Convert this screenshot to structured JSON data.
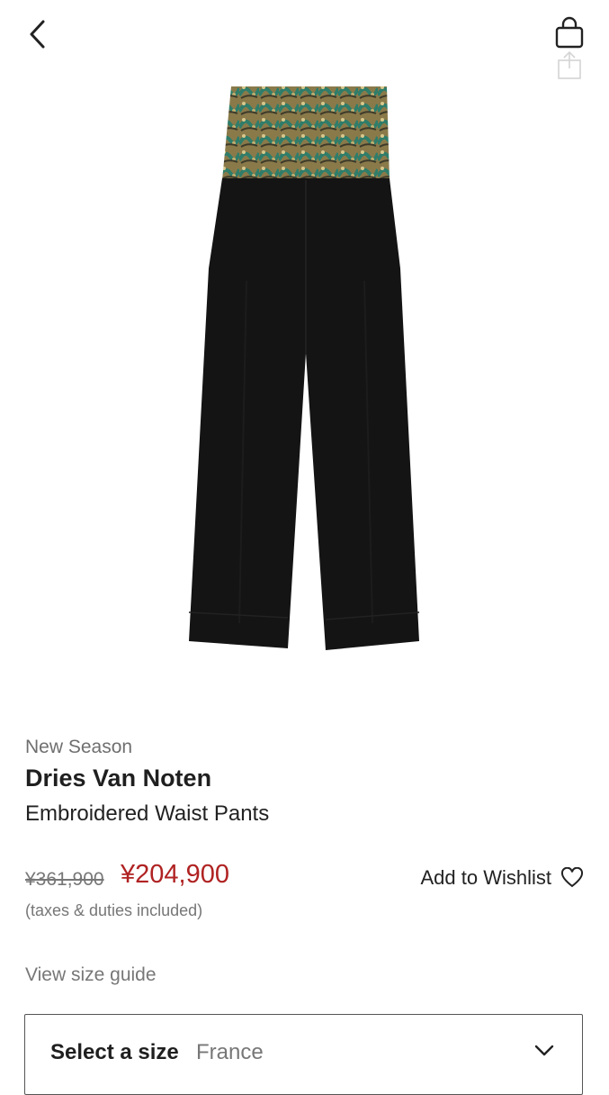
{
  "header": {
    "back_icon": "chevron-left-icon",
    "bag_icon": "shopping-bag-icon",
    "share_icon": "share-icon"
  },
  "product": {
    "image_icon": "product-photo",
    "season": "New Season",
    "brand": "Dries Van Noten",
    "name": "Embroidered Waist Pants",
    "original_price": "¥361,900",
    "sale_price": "¥204,900",
    "tax_note": "(taxes & duties included)",
    "wishlist_label": "Add to Wishlist",
    "wishlist_icon": "heart-outline-icon"
  },
  "size": {
    "guide_link": "View size guide",
    "select_label": "Select a size",
    "region": "France",
    "chevron_icon": "chevron-down-icon"
  },
  "colors": {
    "sale_price": "#b02222",
    "text_primary": "#222222",
    "text_secondary": "#777777",
    "border": "#555555"
  }
}
